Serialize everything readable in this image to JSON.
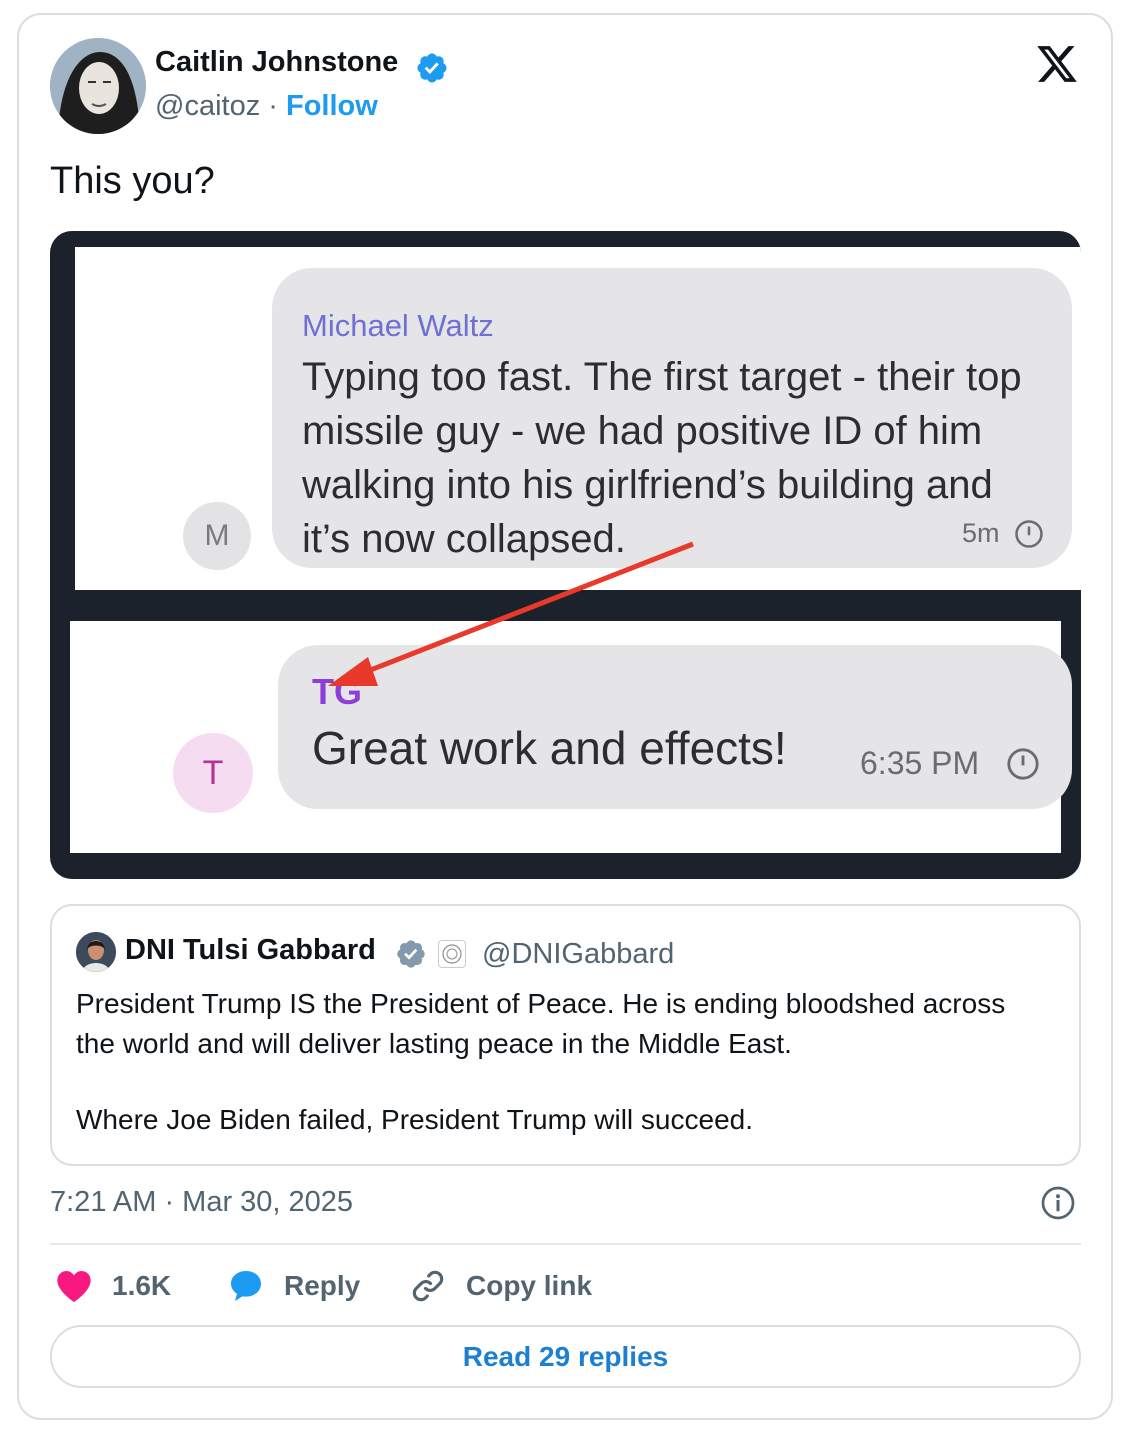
{
  "tweet": {
    "author_name": "Caitlin Johnstone",
    "handle": "@caitoz",
    "separator": "·",
    "follow_label": "Follow",
    "text": "This you?",
    "timestamp": "7:21 AM · Mar 30, 2025"
  },
  "media": {
    "message1": {
      "avatar_letter": "M",
      "sender": "Michael Waltz",
      "text": "Typing too fast. The first target - their top missile guy - we had positive ID of him walking into his girlfriend’s building and it’s now collapsed.",
      "time": "5m"
    },
    "message2": {
      "avatar_letter": "T",
      "sender": "TG",
      "text": "Great work and effects!",
      "time": "6:35 PM"
    }
  },
  "quote": {
    "name": "DNI Tulsi Gabbard",
    "handle": "@DNIGabbard",
    "paragraph1": "President Trump IS the President of Peace. He is ending bloodshed across the world and will deliver lasting peace in the Middle East.",
    "paragraph2": "Where Joe Biden failed, President Trump will succeed."
  },
  "actions": {
    "likes": "1.6K",
    "reply_label": "Reply",
    "copy_label": "Copy link"
  },
  "read_replies_label": "Read 29 replies",
  "icons": [
    "verified-badge-icon",
    "x-logo-icon",
    "clock-icon",
    "info-icon",
    "heart-icon",
    "reply-bubble-icon",
    "link-icon"
  ],
  "colors": {
    "brand_blue": "#1d9bf0",
    "heart_pink": "#f91880",
    "annotation_arrow": "#e8392a",
    "waltz_name": "#6f6fd4",
    "tg_name": "#8e3dd8"
  }
}
